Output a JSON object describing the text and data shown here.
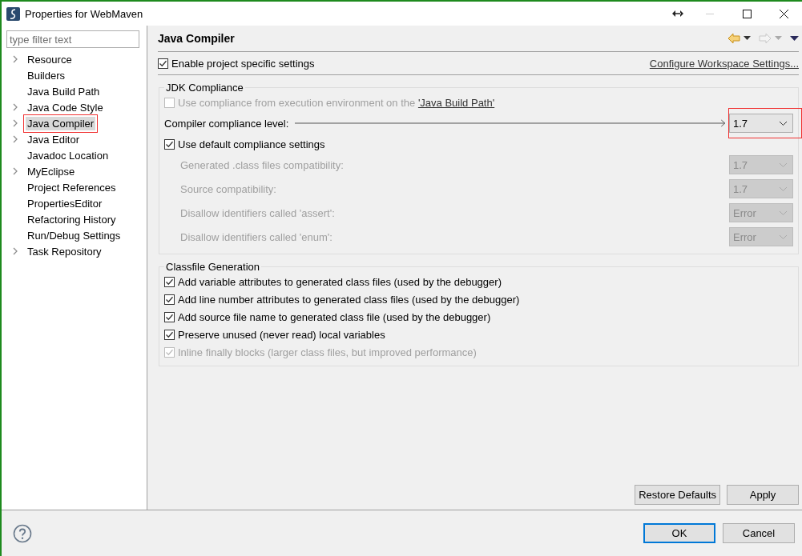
{
  "window": {
    "title": "Properties for WebMaven"
  },
  "sidebar": {
    "filter": {
      "placeholder": "type filter text"
    },
    "items": [
      {
        "label": "Resource",
        "expandable": true,
        "selected": false,
        "annotated": false
      },
      {
        "label": "Builders",
        "expandable": false,
        "selected": false,
        "annotated": false
      },
      {
        "label": "Java Build Path",
        "expandable": false,
        "selected": false,
        "annotated": false
      },
      {
        "label": "Java Code Style",
        "expandable": true,
        "selected": false,
        "annotated": false
      },
      {
        "label": "Java Compiler",
        "expandable": true,
        "selected": true,
        "annotated": true
      },
      {
        "label": "Java Editor",
        "expandable": true,
        "selected": false,
        "annotated": false
      },
      {
        "label": "Javadoc Location",
        "expandable": false,
        "selected": false,
        "annotated": false
      },
      {
        "label": "MyEclipse",
        "expandable": true,
        "selected": false,
        "annotated": false
      },
      {
        "label": "Project References",
        "expandable": false,
        "selected": false,
        "annotated": false
      },
      {
        "label": "PropertiesEditor",
        "expandable": false,
        "selected": false,
        "annotated": false
      },
      {
        "label": "Refactoring History",
        "expandable": false,
        "selected": false,
        "annotated": false
      },
      {
        "label": "Run/Debug Settings",
        "expandable": false,
        "selected": false,
        "annotated": false
      },
      {
        "label": "Task Repository",
        "expandable": true,
        "selected": false,
        "annotated": false
      }
    ]
  },
  "page": {
    "title": "Java Compiler",
    "enable_specific": {
      "label": "Enable project specific settings",
      "checked": true
    },
    "configure_link": "Configure Workspace Settings...",
    "jdk_compliance": {
      "title": "JDK Compliance",
      "use_environment": {
        "text": "Use compliance from execution environment on the ",
        "link": "'Java Build Path'",
        "checked": false,
        "disabled": true
      },
      "compliance_level": {
        "label": "Compiler compliance level:",
        "value": "1.7",
        "annotated": true
      },
      "use_default": {
        "label": "Use default compliance settings",
        "checked": true
      },
      "settings": [
        {
          "label": "Generated .class files compatibility:",
          "value": "1.7",
          "disabled": true
        },
        {
          "label": "Source compatibility:",
          "value": "1.7",
          "disabled": true
        },
        {
          "label": "Disallow identifiers called 'assert':",
          "value": "Error",
          "disabled": true
        },
        {
          "label": "Disallow identifiers called 'enum':",
          "value": "Error",
          "disabled": true
        }
      ]
    },
    "classfile_generation": {
      "title": "Classfile Generation",
      "options": [
        {
          "label": "Add variable attributes to generated class files (used by the debugger)",
          "checked": true,
          "disabled": false
        },
        {
          "label": "Add line number attributes to generated class files (used by the debugger)",
          "checked": true,
          "disabled": false
        },
        {
          "label": "Add source file name to generated class file (used by the debugger)",
          "checked": true,
          "disabled": false
        },
        {
          "label": "Preserve unused (never read) local variables",
          "checked": true,
          "disabled": false
        },
        {
          "label": "Inline finally blocks (larger class files, but improved performance)",
          "checked": true,
          "disabled": true
        }
      ]
    },
    "buttons": [
      "Restore Defaults",
      "Apply"
    ]
  },
  "footer": {
    "buttons": [
      {
        "label": "OK",
        "default": true
      },
      {
        "label": "Cancel",
        "default": false
      }
    ]
  }
}
